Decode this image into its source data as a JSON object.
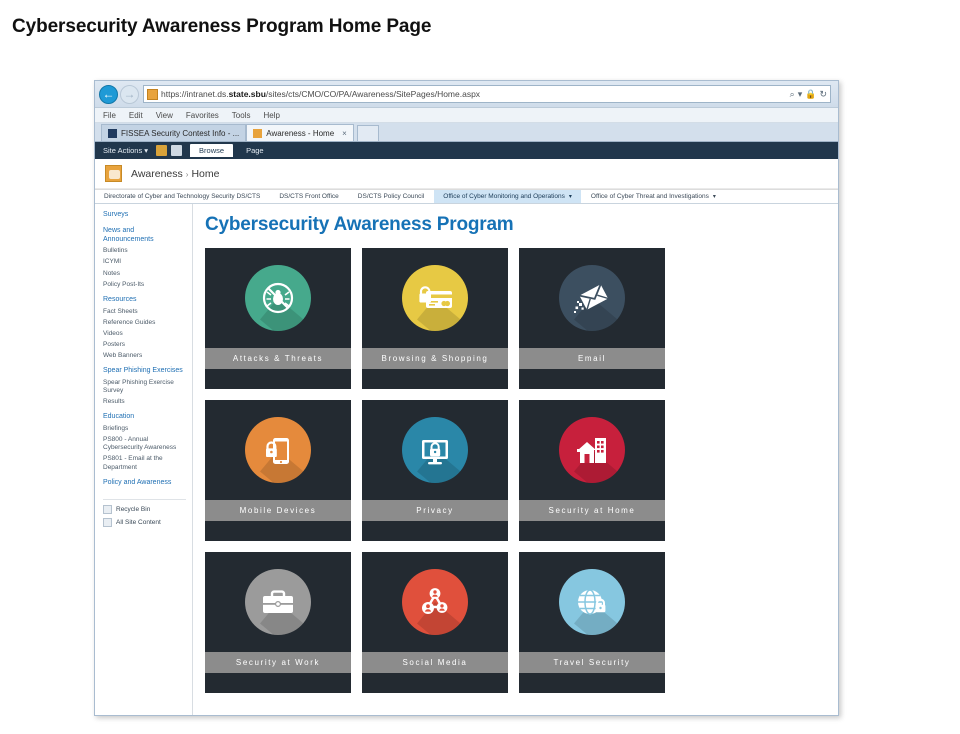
{
  "slide": {
    "title": "Cybersecurity Awareness Program Home Page"
  },
  "browser": {
    "back_glyph": "←",
    "forward_glyph": "→",
    "favicon_name": "site-favicon",
    "url_prefix": "https://intranet.ds.",
    "url_domain": "state.sbu",
    "url_path": "/sites/cts/CMO/CO/PA/Awareness/SitePages/Home.aspx",
    "url_full": "https://intranet.ds.state.sbu/sites/cts/CMO/CO/PA/Awareness/SitePages/Home.aspx",
    "search_glyph": "⌕",
    "dropdown_glyph": "▾",
    "lock_glyph": "A",
    "refresh_glyph": "↻",
    "menu": [
      "File",
      "Edit",
      "View",
      "Favorites",
      "Tools",
      "Help"
    ],
    "tabs": [
      {
        "label": "FISSEA Security Contest Info - ...",
        "active": false,
        "close": ""
      },
      {
        "label": "Awareness - Home",
        "active": true,
        "close": "×"
      }
    ]
  },
  "sharepoint": {
    "site_actions": "Site Actions ▾",
    "ribbon_tabs": [
      {
        "label": "Browse",
        "active": true
      },
      {
        "label": "Page",
        "active": false
      }
    ],
    "breadcrumb": {
      "site": "Awareness",
      "separator": "›",
      "page": "Home"
    },
    "topnav": [
      {
        "label": "Directorate of Cyber and Technology Security DS/CTS",
        "selected": false,
        "caret": ""
      },
      {
        "label": "DS/CTS Front Office",
        "selected": false,
        "caret": ""
      },
      {
        "label": "DS/CTS Policy Council",
        "selected": false,
        "caret": ""
      },
      {
        "label": "Office of Cyber Monitoring and Operations",
        "selected": true,
        "caret": "▾"
      },
      {
        "label": "Office of Cyber Threat and Investigations",
        "selected": false,
        "caret": "▾"
      }
    ],
    "quick_launch": [
      {
        "type": "head",
        "label": "Surveys"
      },
      {
        "type": "head",
        "label": "News and Announcements"
      },
      {
        "type": "link",
        "label": "Bulletins"
      },
      {
        "type": "link",
        "label": "ICYMI"
      },
      {
        "type": "link",
        "label": "Notes"
      },
      {
        "type": "link",
        "label": "Policy Post-Its"
      },
      {
        "type": "head",
        "label": "Resources"
      },
      {
        "type": "link",
        "label": "Fact Sheets"
      },
      {
        "type": "link",
        "label": "Reference Guides"
      },
      {
        "type": "link",
        "label": "Videos"
      },
      {
        "type": "link",
        "label": "Posters"
      },
      {
        "type": "link",
        "label": "Web Banners"
      },
      {
        "type": "head",
        "label": "Spear Phishing Exercises"
      },
      {
        "type": "link",
        "label": "Spear Phishing Exercise Survey"
      },
      {
        "type": "link",
        "label": "Results"
      },
      {
        "type": "head",
        "label": "Education"
      },
      {
        "type": "link",
        "label": "Briefings"
      },
      {
        "type": "link",
        "label": "PS800 - Annual Cybersecurity Awareness"
      },
      {
        "type": "link",
        "label": "PS801 - Email at the Department"
      },
      {
        "type": "head",
        "label": "Policy and Awareness"
      }
    ],
    "quick_launch_system": [
      {
        "label": "Recycle Bin",
        "icon": "recycle-bin-icon"
      },
      {
        "label": "All Site Content",
        "icon": "all-site-content-icon"
      }
    ],
    "page_heading": "Cybersecurity Awareness Program",
    "tiles": [
      {
        "label": "Attacks & Threats",
        "icon": "bug-blocked-icon",
        "color": "#46a98c"
      },
      {
        "label": "Browsing & Shopping",
        "icon": "credit-card-lock-icon",
        "color": "#e7c944"
      },
      {
        "label": "Email",
        "icon": "envelope-icon",
        "color": "#3c4f60"
      },
      {
        "label": "Mobile Devices",
        "icon": "phone-lock-icon",
        "color": "#e58a3c"
      },
      {
        "label": "Privacy",
        "icon": "monitor-lock-icon",
        "color": "#2a87a8"
      },
      {
        "label": "Security at Home",
        "icon": "house-icon",
        "color": "#c7203c"
      },
      {
        "label": "Security at Work",
        "icon": "briefcase-icon",
        "color": "#9b9b9b"
      },
      {
        "label": "Social Media",
        "icon": "people-network-icon",
        "color": "#e0503c"
      },
      {
        "label": "Travel Security",
        "icon": "globe-lock-icon",
        "color": "#86c7e0"
      }
    ],
    "tile_background": "#232a31",
    "tile_label_background": "#8c8c8c",
    "heading_color": "#1672b6"
  }
}
